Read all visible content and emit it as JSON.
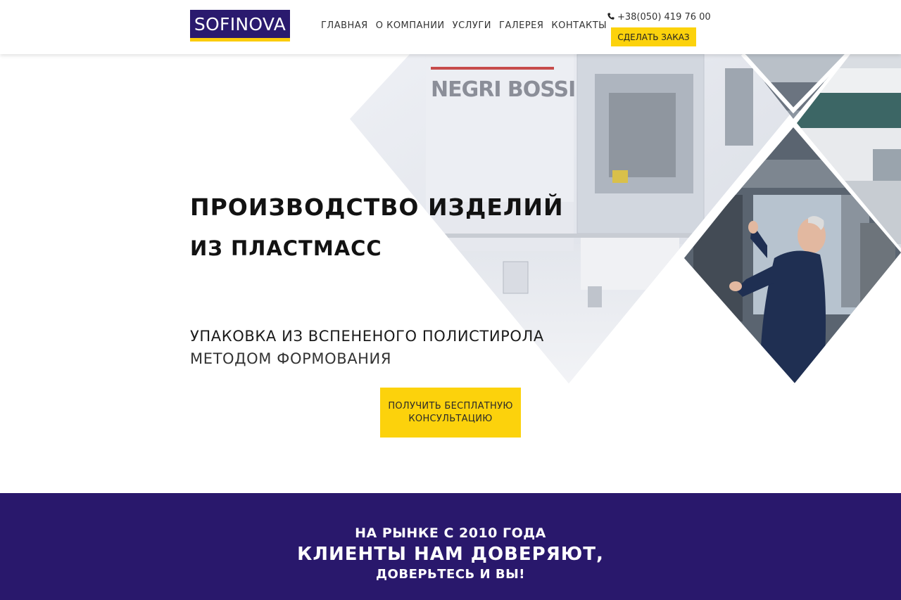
{
  "header": {
    "logo": "SOFINOVA",
    "nav": [
      {
        "label": "ГЛАВНАЯ"
      },
      {
        "label": "О КОМПАНИИ"
      },
      {
        "label": "УСЛУГИ"
      },
      {
        "label": "ГАЛЕРЕЯ"
      },
      {
        "label": "КОНТАКТЫ"
      }
    ],
    "phone": "+38(050) 419 76 00",
    "phone_icon": "phone-icon",
    "order_button": "СДЕЛАТЬ ЗАКАЗ"
  },
  "hero": {
    "title_line1": "ПРОИЗВОДСТВО ИЗДЕЛИЙ",
    "title_line2": "ИЗ ПЛАСТМАСС",
    "subtitle_line1": "УПАКОВКА ИЗ ВСПЕНЕНОГО ПОЛИСТИРОЛА",
    "subtitle_line2": "МЕТОДОМ ФОРМОВАНИЯ",
    "machine_brand": "NEGRI BOSSI",
    "consult_button_line1": "ПОЛУЧИТЬ БЕСПЛАТНУЮ",
    "consult_button_line2": "КОНСУЛЬТАЦИЮ"
  },
  "trust_band": {
    "line1": "НА РЫНКЕ С 2010 ГОДА",
    "line2": "КЛИЕНТЫ НАМ ДОВЕРЯЮТ,",
    "line3": "ДОВЕРЬТЕСЬ И ВЫ!"
  },
  "colors": {
    "brand_purple": "#29186c",
    "accent_yellow": "#fcd20c"
  }
}
